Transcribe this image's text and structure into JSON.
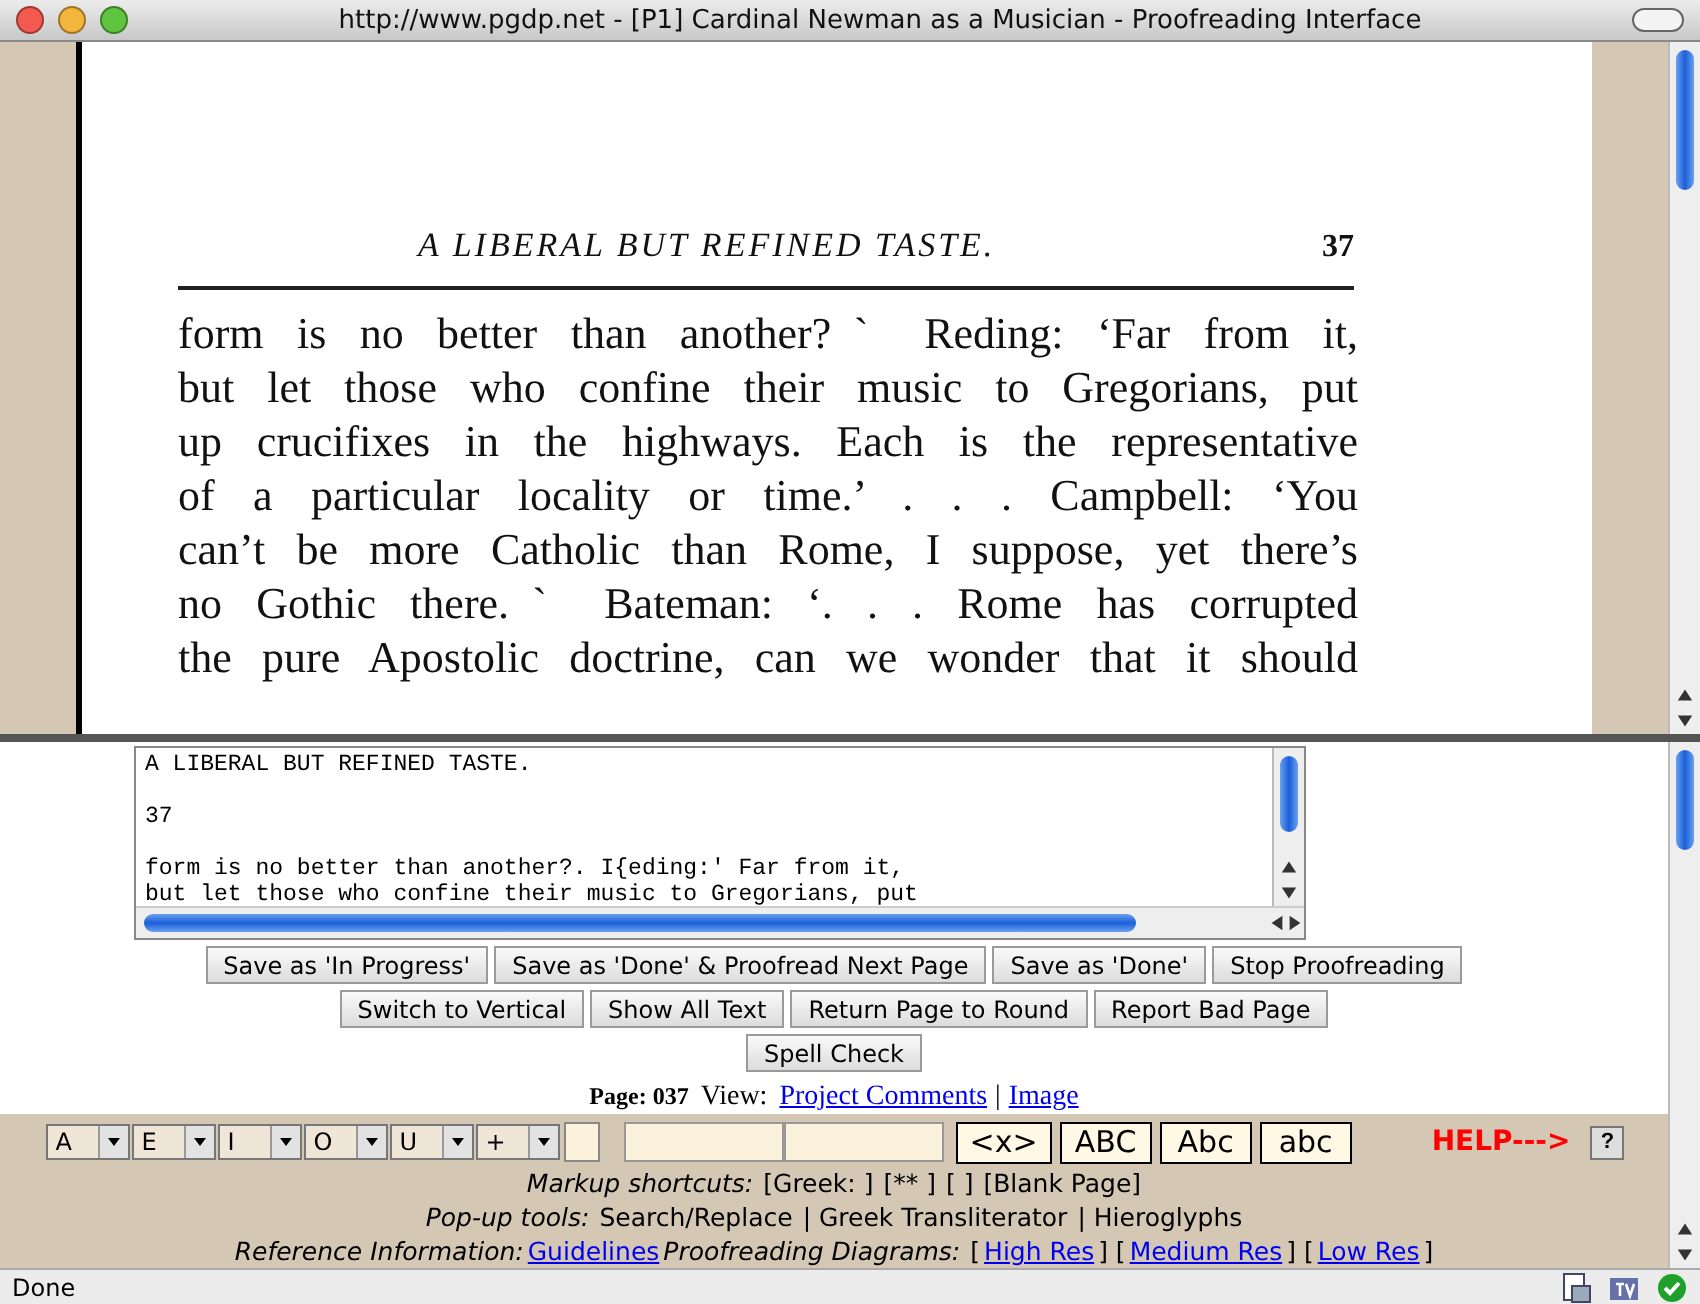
{
  "window": {
    "title": "http://www.pgdp.net - [P1] Cardinal Newman as a Musician - Proofreading Interface"
  },
  "scan": {
    "running_head": "A LIBERAL BUT REFINED TASTE.",
    "page_number": "37",
    "lines": [
      "form is no better than another?ˋ  Reding: ‘Far from it,",
      "but let those who confine their music to Gregorians, put",
      "up crucifixes in the highways.  Each is the representative",
      "of a particular locality or time.’ . . . Campbell: ‘You",
      "can’t be more Catholic than Rome, I suppose, yet there’s",
      "no Gothic there.ˋ  Bateman: ‘. . . Rome has corrupted",
      "the pure Apostolic doctrine, can we wonder that it should"
    ]
  },
  "editor": {
    "value": "A LIBERAL BUT REFINED TASTE.\n\n37\n\nform is no better than another?. I{eding:' Far from it,\nbut let those who confine their music to Gregorians, put"
  },
  "button_rows": [
    [
      "Save as 'In Progress'",
      "Save as 'Done' & Proofread Next Page",
      "Save as 'Done'",
      "Stop Proofreading"
    ],
    [
      "Switch to Vertical",
      "Show All Text",
      "Return Page to Round",
      "Report Bad Page"
    ],
    [
      "Spell Check"
    ]
  ],
  "page_info": {
    "label": "Page: 037",
    "view_label": "View:",
    "links": [
      "Project Comments",
      "Image"
    ],
    "separator": "|"
  },
  "toolbar": {
    "selects": [
      "A",
      "E",
      "I",
      "O",
      "U",
      "+"
    ],
    "case_buttons": [
      "<x>",
      "ABC",
      "Abc",
      "abc"
    ],
    "help": "HELP--->",
    "help_button": "?"
  },
  "info_lines": [
    {
      "label": "Markup shortcuts:",
      "items": [
        {
          "text": "[Greek: ]",
          "link": false
        },
        {
          "text": "[** ]",
          "link": false
        },
        {
          "text": "[ ]",
          "link": false
        },
        {
          "text": "[Blank Page]",
          "link": false
        }
      ]
    },
    {
      "label": "Pop-up tools:",
      "items": [
        {
          "text": "Search/Replace",
          "link": false
        },
        {
          "text": "| Greek Transliterator",
          "link": false
        },
        {
          "text": "| Hieroglyphs",
          "link": false
        }
      ]
    },
    {
      "label": "Reference Information:",
      "items": [
        {
          "text": "Guidelines",
          "link": true
        },
        {
          "text": "Proofreading Diagrams:",
          "link": false,
          "italic": true
        },
        {
          "text": "[",
          "link": false
        },
        {
          "text": "High Res",
          "link": true
        },
        {
          "text": "] [",
          "link": false
        },
        {
          "text": "Medium Res",
          "link": true
        },
        {
          "text": "] [",
          "link": false
        },
        {
          "text": "Low Res",
          "link": true
        },
        {
          "text": "]",
          "link": false
        }
      ]
    }
  ],
  "status_bar": {
    "text": "Done"
  }
}
